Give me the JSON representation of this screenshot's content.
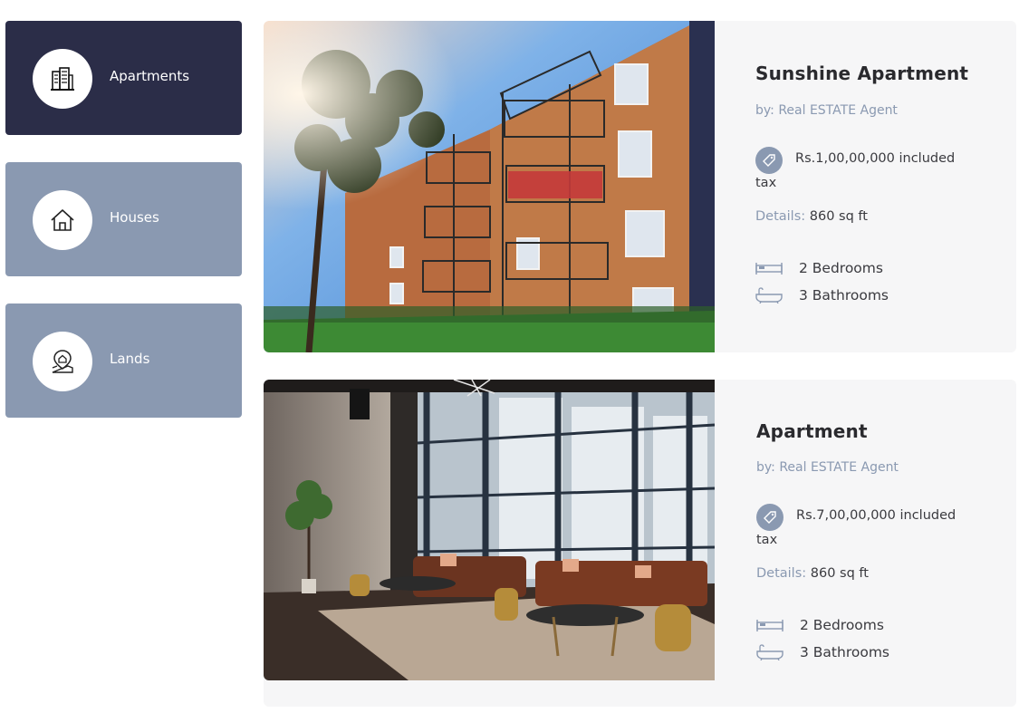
{
  "categories": [
    {
      "label": "Apartments",
      "icon": "building-icon",
      "active": true
    },
    {
      "label": "Houses",
      "icon": "house-icon",
      "active": false
    },
    {
      "label": "Lands",
      "icon": "land-pin-icon",
      "active": false
    }
  ],
  "listings": [
    {
      "title": "Sunshine Apartment",
      "agent": "by: Real ESTATE Agent",
      "price": "Rs.1,00,00,000 included tax",
      "details_label": "Details:",
      "details_value": "860 sq ft",
      "bedrooms": "2 Bedrooms",
      "bathrooms": "3 Bathrooms",
      "image": "apartment-building-exterior-photo"
    },
    {
      "title": "Apartment",
      "agent": "by: Real ESTATE Agent",
      "price": "Rs.7,00,00,000 included tax",
      "details_label": "Details:",
      "details_value": "860 sq ft",
      "bedrooms": "2 Bedrooms",
      "bathrooms": "3 Bathrooms",
      "image": "apartment-lounge-interior-photo"
    }
  ],
  "colors": {
    "active": "#2b2d48",
    "inactive": "#8a99b1",
    "card_bg": "#f6f6f7",
    "muted_text": "#8a99b1"
  }
}
